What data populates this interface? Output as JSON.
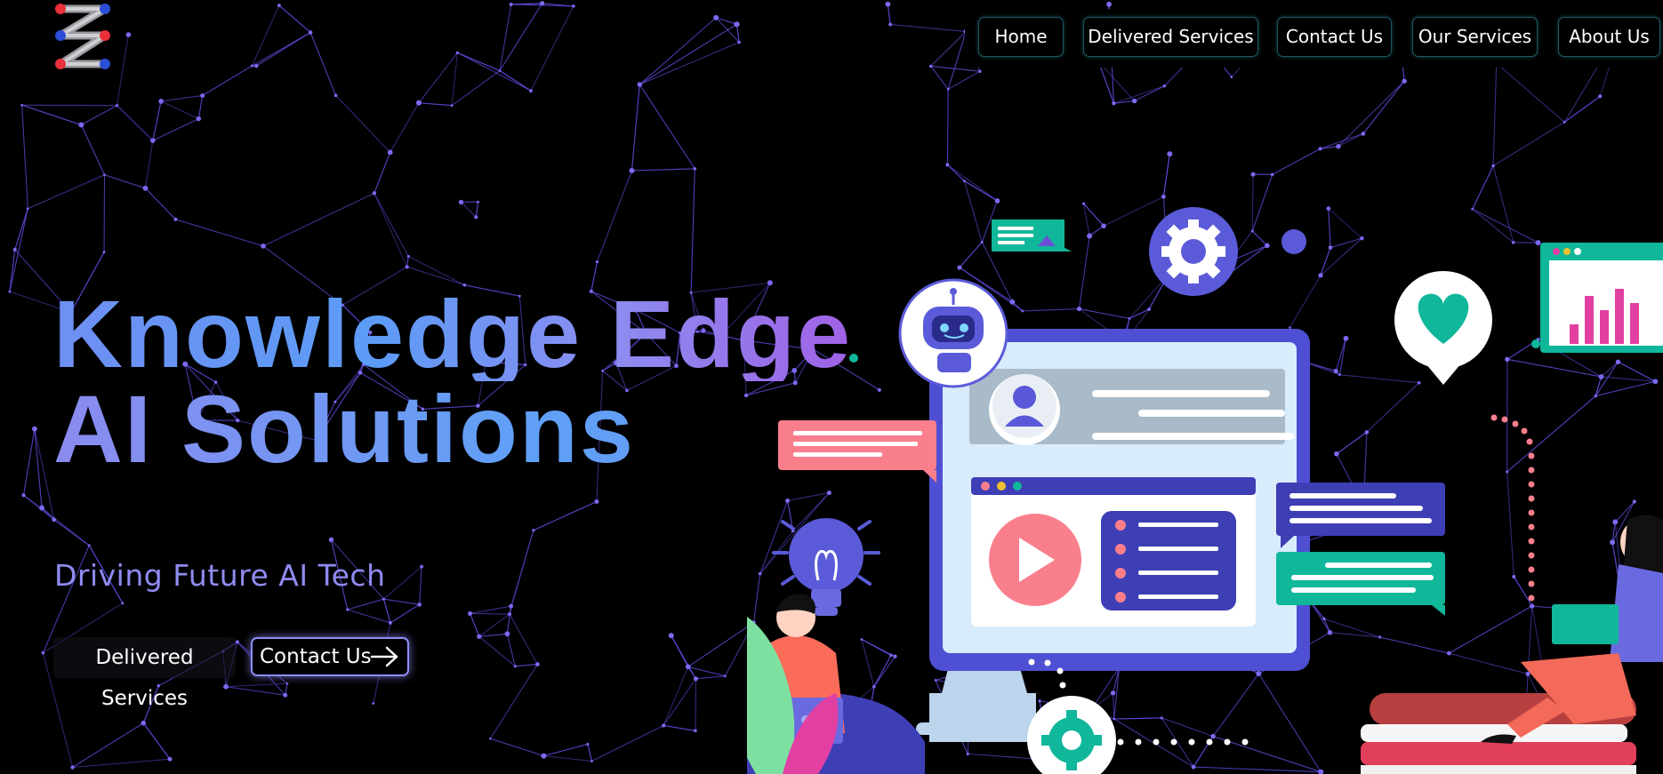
{
  "nav": {
    "items": [
      {
        "label": "Home"
      },
      {
        "label": "Delivered Services"
      },
      {
        "label": "Contact Us"
      },
      {
        "label": "Our Services"
      },
      {
        "label": "About Us"
      }
    ]
  },
  "hero": {
    "title_line1": "Knowledge Edge",
    "title_line2": "AI Solutions",
    "subtitle": "Driving Future AI Tech",
    "cta_primary": "Delivered Services",
    "cta_secondary": "Contact Us"
  },
  "colors": {
    "background": "#000000",
    "accent": "#8e8ef6",
    "network": "#5a4bd8",
    "teal": "#10b79a",
    "coral": "#fa7f8c",
    "pink": "#e23fa3"
  },
  "icons": [
    "logo-icon",
    "arrow-right-icon",
    "robot-icon",
    "gear-icon",
    "heart-pin-icon",
    "user-avatar-icon",
    "play-icon",
    "lightbulb-icon",
    "bar-chart-icon",
    "image-card-icon",
    "leaf-icon"
  ]
}
